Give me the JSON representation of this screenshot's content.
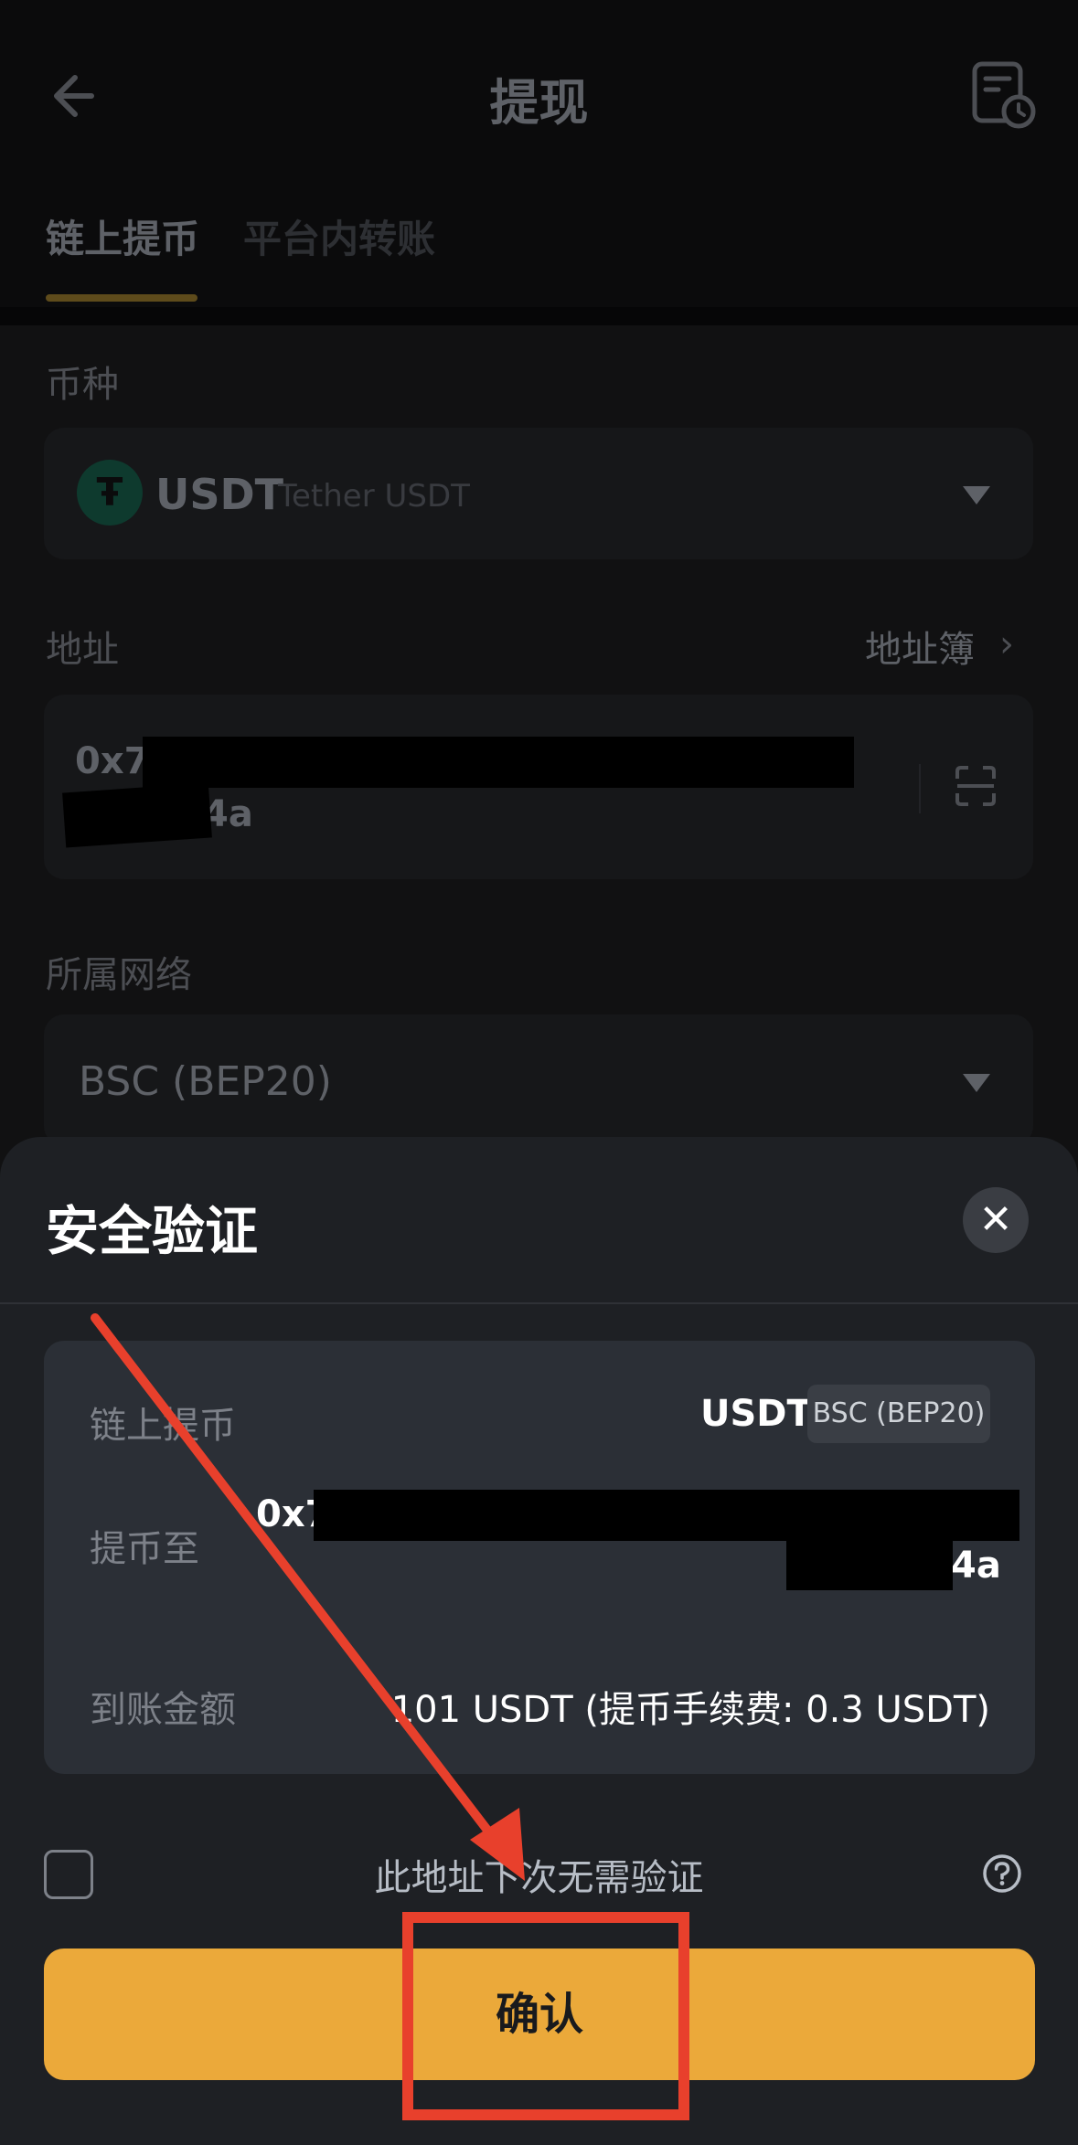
{
  "header": {
    "title": "提现",
    "tabs": [
      {
        "label": "链上提币"
      },
      {
        "label": "平台内转账"
      }
    ]
  },
  "form": {
    "coin_label": "币种",
    "coin_icon": "Ŧ",
    "coin_symbol": "USDT",
    "coin_name": "Tether USDT",
    "address_label": "地址",
    "address_book_label": "地址簿",
    "address_book_chevron": "›",
    "address_prefix": "0x7",
    "address_suffix": "4a",
    "network_label": "所属网络",
    "network_value": "BSC (BEP20)"
  },
  "dialog": {
    "title": "安全验证",
    "close_glyph": "✕",
    "method_label": "链上提币",
    "coin": "USDT",
    "network_badge": "BSC (BEP20)",
    "to_label": "提币至",
    "to_prefix": "0x7",
    "to_suffix": "4a",
    "amount_label": "到账金额",
    "amount_value": "101 USDT (提币手续费: 0.3 USDT)",
    "skip_label": "此地址下次无需验证",
    "confirm_label": "确认"
  },
  "colors": {
    "accent": "#eba93a",
    "sheet_bg": "#1e2024",
    "annotation_red": "#e8402c"
  }
}
